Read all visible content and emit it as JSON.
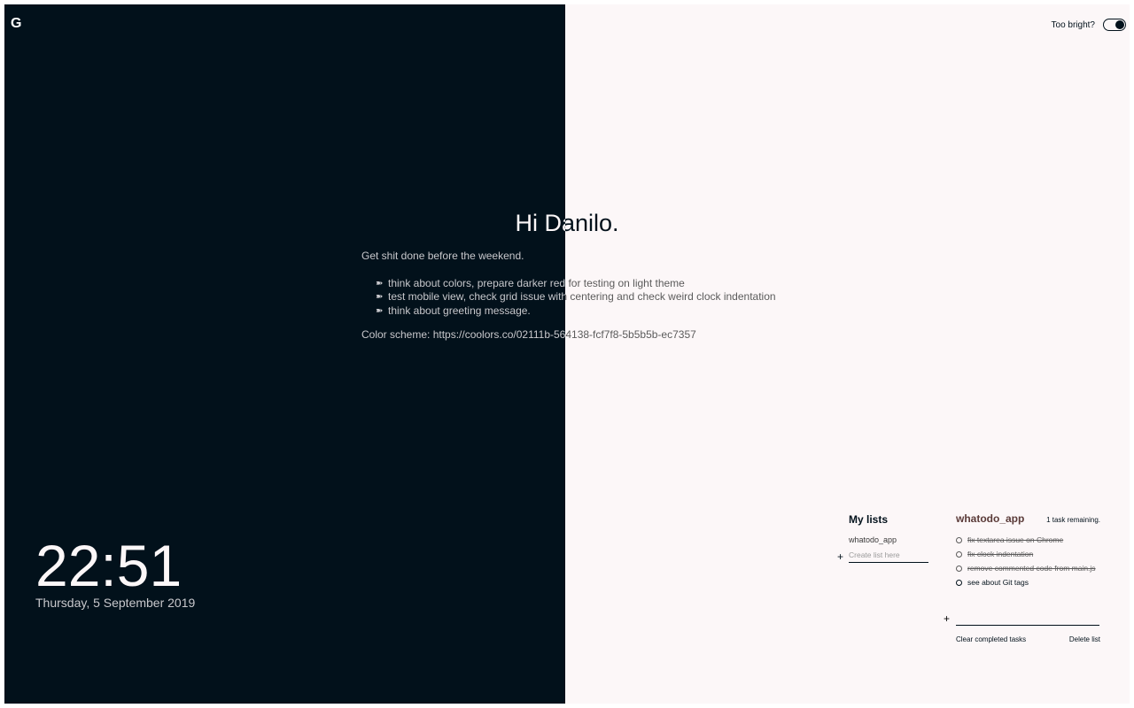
{
  "logo": {
    "letter": "G"
  },
  "theme_toggle": {
    "label": "Too bright?",
    "state": "on"
  },
  "colors": {
    "dark": "#02111b",
    "light": "#fcf7f8",
    "grey": "#5b5b5b",
    "accent": "#ec7357"
  },
  "center": {
    "greeting": "Hi Danilo.",
    "intro": "Get shit done before the weekend.",
    "todos": [
      {
        "icon": "double-arrow-icon",
        "text": "think about colors, prepare darker red for testing on light theme"
      },
      {
        "icon": "double-arrow-icon",
        "text": "test mobile view, check grid issue with centering and check weird clock indentation"
      },
      {
        "icon": "double-arrow-icon",
        "text": "think about greeting message."
      }
    ],
    "color_scheme": "Color scheme: https://coolors.co/02111b-564138-fcf7f8-5b5b5b-ec7357"
  },
  "clock": {
    "time": "22:51",
    "date": "Thursday, 5 September 2019"
  },
  "lists": {
    "heading": "My lists",
    "items": [
      {
        "name": "whatodo_app"
      }
    ],
    "create_placeholder": "Create list here",
    "create_icon": "plus-icon"
  },
  "tasks": {
    "list_title": "whatodo_app",
    "remaining": "1 task remaining.",
    "items": [
      {
        "label": "fix textarea issue on Chrome",
        "done": true
      },
      {
        "label": "fix clock indentation",
        "done": true
      },
      {
        "label": "remove commented code from main.js",
        "done": true
      },
      {
        "label": "see about Git tags",
        "done": false
      }
    ],
    "new_task_placeholder": "",
    "clear_completed": "Clear completed tasks",
    "delete_list": "Delete list"
  }
}
